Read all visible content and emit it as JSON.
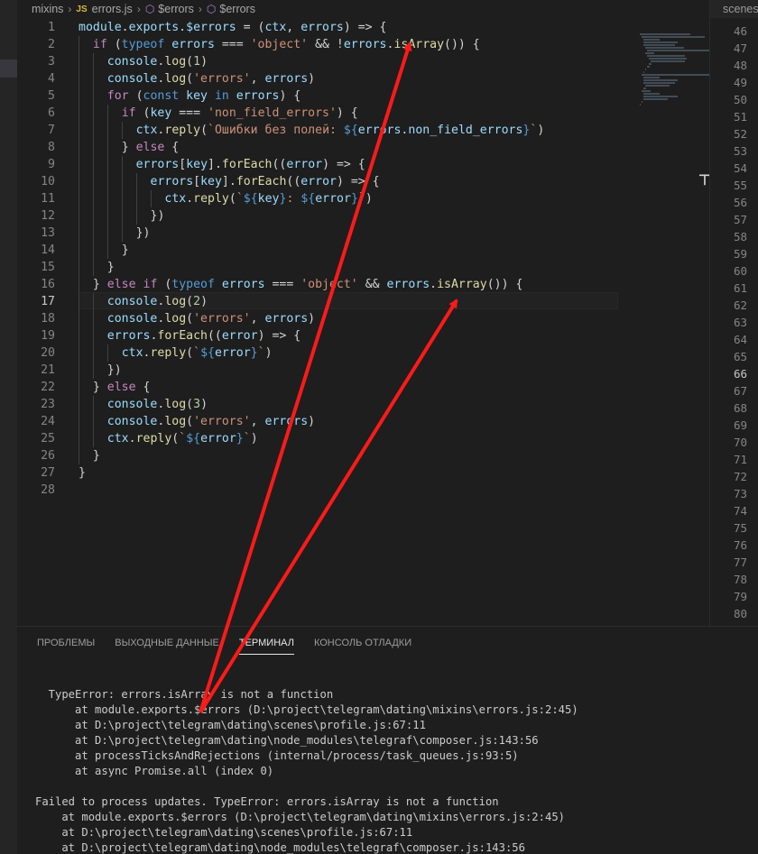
{
  "breadcrumb": {
    "items": [
      "mixins",
      "errors.js",
      "$errors",
      "$errors"
    ],
    "js_badge": "JS"
  },
  "right_pane": {
    "tab_label": "scenes",
    "line_numbers": [
      "46",
      "47",
      "48",
      "49",
      "50",
      "51",
      "52",
      "53",
      "54",
      "55",
      "56",
      "57",
      "58",
      "59",
      "60",
      "61",
      "62",
      "63",
      "64",
      "65",
      "66",
      "67",
      "68",
      "69",
      "70",
      "71",
      "72",
      "73",
      "74",
      "75",
      "76",
      "77",
      "78",
      "79",
      "80"
    ],
    "active_line": "66"
  },
  "editor": {
    "active_line": "17",
    "lines": [
      {
        "n": "1",
        "indent": 0,
        "tokens": [
          {
            "t": "module",
            "c": "var"
          },
          {
            "t": ".",
            "c": "plain"
          },
          {
            "t": "exports",
            "c": "var"
          },
          {
            "t": ".",
            "c": "plain"
          },
          {
            "t": "$errors",
            "c": "var"
          },
          {
            "t": " = (",
            "c": "plain"
          },
          {
            "t": "ctx",
            "c": "var"
          },
          {
            "t": ", ",
            "c": "plain"
          },
          {
            "t": "errors",
            "c": "var"
          },
          {
            "t": ") => {",
            "c": "plain"
          }
        ]
      },
      {
        "n": "2",
        "indent": 1,
        "tokens": [
          {
            "t": "if",
            "c": "kw"
          },
          {
            "t": " (",
            "c": "plain"
          },
          {
            "t": "typeof",
            "c": "kw2"
          },
          {
            "t": " ",
            "c": "plain"
          },
          {
            "t": "errors",
            "c": "var"
          },
          {
            "t": " === ",
            "c": "plain"
          },
          {
            "t": "'object'",
            "c": "str"
          },
          {
            "t": " && !",
            "c": "plain"
          },
          {
            "t": "errors",
            "c": "var"
          },
          {
            "t": ".",
            "c": "plain"
          },
          {
            "t": "isArray",
            "c": "fn"
          },
          {
            "t": "()) {",
            "c": "plain"
          }
        ]
      },
      {
        "n": "3",
        "indent": 2,
        "tokens": [
          {
            "t": "console",
            "c": "var"
          },
          {
            "t": ".",
            "c": "plain"
          },
          {
            "t": "log",
            "c": "fn"
          },
          {
            "t": "(",
            "c": "plain"
          },
          {
            "t": "1",
            "c": "num"
          },
          {
            "t": ")",
            "c": "plain"
          }
        ]
      },
      {
        "n": "4",
        "indent": 2,
        "tokens": [
          {
            "t": "console",
            "c": "var"
          },
          {
            "t": ".",
            "c": "plain"
          },
          {
            "t": "log",
            "c": "fn"
          },
          {
            "t": "(",
            "c": "plain"
          },
          {
            "t": "'errors'",
            "c": "str"
          },
          {
            "t": ", ",
            "c": "plain"
          },
          {
            "t": "errors",
            "c": "var"
          },
          {
            "t": ")",
            "c": "plain"
          }
        ]
      },
      {
        "n": "5",
        "indent": 2,
        "tokens": [
          {
            "t": "for",
            "c": "kw"
          },
          {
            "t": " (",
            "c": "plain"
          },
          {
            "t": "const",
            "c": "kw2"
          },
          {
            "t": " ",
            "c": "plain"
          },
          {
            "t": "key",
            "c": "var"
          },
          {
            "t": " ",
            "c": "plain"
          },
          {
            "t": "in",
            "c": "kw2"
          },
          {
            "t": " ",
            "c": "plain"
          },
          {
            "t": "errors",
            "c": "var"
          },
          {
            "t": ") {",
            "c": "plain"
          }
        ]
      },
      {
        "n": "6",
        "indent": 3,
        "tokens": [
          {
            "t": "if",
            "c": "kw"
          },
          {
            "t": " (",
            "c": "plain"
          },
          {
            "t": "key",
            "c": "var"
          },
          {
            "t": " === ",
            "c": "plain"
          },
          {
            "t": "'non_field_errors'",
            "c": "str"
          },
          {
            "t": ") {",
            "c": "plain"
          }
        ]
      },
      {
        "n": "7",
        "indent": 4,
        "tokens": [
          {
            "t": "ctx",
            "c": "var"
          },
          {
            "t": ".",
            "c": "plain"
          },
          {
            "t": "reply",
            "c": "fn"
          },
          {
            "t": "(",
            "c": "plain"
          },
          {
            "t": "`Ошибки без полей: ",
            "c": "tpl"
          },
          {
            "t": "${",
            "c": "kw2"
          },
          {
            "t": "errors",
            "c": "var"
          },
          {
            "t": ".",
            "c": "plain"
          },
          {
            "t": "non_field_errors",
            "c": "var"
          },
          {
            "t": "}",
            "c": "kw2"
          },
          {
            "t": "`",
            "c": "tpl"
          },
          {
            "t": ")",
            "c": "plain"
          }
        ]
      },
      {
        "n": "8",
        "indent": 3,
        "tokens": [
          {
            "t": "} ",
            "c": "plain"
          },
          {
            "t": "else",
            "c": "kw"
          },
          {
            "t": " {",
            "c": "plain"
          }
        ]
      },
      {
        "n": "9",
        "indent": 4,
        "tokens": [
          {
            "t": "errors",
            "c": "var"
          },
          {
            "t": "[",
            "c": "plain"
          },
          {
            "t": "key",
            "c": "var"
          },
          {
            "t": "].",
            "c": "plain"
          },
          {
            "t": "forEach",
            "c": "fn"
          },
          {
            "t": "((",
            "c": "plain"
          },
          {
            "t": "error",
            "c": "var"
          },
          {
            "t": ") => {",
            "c": "plain"
          }
        ]
      },
      {
        "n": "10",
        "indent": 5,
        "tokens": [
          {
            "t": "errors",
            "c": "var"
          },
          {
            "t": "[",
            "c": "plain"
          },
          {
            "t": "key",
            "c": "var"
          },
          {
            "t": "].",
            "c": "plain"
          },
          {
            "t": "forEach",
            "c": "fn"
          },
          {
            "t": "((",
            "c": "plain"
          },
          {
            "t": "error",
            "c": "var"
          },
          {
            "t": ") => {",
            "c": "plain"
          }
        ]
      },
      {
        "n": "11",
        "indent": 6,
        "tokens": [
          {
            "t": "ctx",
            "c": "var"
          },
          {
            "t": ".",
            "c": "plain"
          },
          {
            "t": "reply",
            "c": "fn"
          },
          {
            "t": "(",
            "c": "plain"
          },
          {
            "t": "`",
            "c": "tpl"
          },
          {
            "t": "${",
            "c": "kw2"
          },
          {
            "t": "key",
            "c": "var"
          },
          {
            "t": "}",
            "c": "kw2"
          },
          {
            "t": ": ",
            "c": "tpl"
          },
          {
            "t": "${",
            "c": "kw2"
          },
          {
            "t": "error",
            "c": "var"
          },
          {
            "t": "}",
            "c": "kw2"
          },
          {
            "t": "`",
            "c": "tpl"
          },
          {
            "t": ")",
            "c": "plain"
          }
        ]
      },
      {
        "n": "12",
        "indent": 5,
        "tokens": [
          {
            "t": "})",
            "c": "plain"
          }
        ]
      },
      {
        "n": "13",
        "indent": 4,
        "tokens": [
          {
            "t": "})",
            "c": "plain"
          }
        ]
      },
      {
        "n": "14",
        "indent": 3,
        "tokens": [
          {
            "t": "}",
            "c": "plain"
          }
        ]
      },
      {
        "n": "15",
        "indent": 2,
        "tokens": [
          {
            "t": "}",
            "c": "plain"
          }
        ]
      },
      {
        "n": "16",
        "indent": 1,
        "tokens": [
          {
            "t": "} ",
            "c": "plain"
          },
          {
            "t": "else",
            "c": "kw"
          },
          {
            "t": " ",
            "c": "plain"
          },
          {
            "t": "if",
            "c": "kw"
          },
          {
            "t": " (",
            "c": "plain"
          },
          {
            "t": "typeof",
            "c": "kw2"
          },
          {
            "t": " ",
            "c": "plain"
          },
          {
            "t": "errors",
            "c": "var"
          },
          {
            "t": " === ",
            "c": "plain"
          },
          {
            "t": "'object'",
            "c": "str"
          },
          {
            "t": " && ",
            "c": "plain"
          },
          {
            "t": "errors",
            "c": "var"
          },
          {
            "t": ".",
            "c": "plain"
          },
          {
            "t": "isArray",
            "c": "fn"
          },
          {
            "t": "()) {",
            "c": "plain"
          }
        ]
      },
      {
        "n": "17",
        "indent": 2,
        "tokens": [
          {
            "t": "console",
            "c": "var"
          },
          {
            "t": ".",
            "c": "plain"
          },
          {
            "t": "log",
            "c": "fn"
          },
          {
            "t": "(",
            "c": "plain"
          },
          {
            "t": "2",
            "c": "num"
          },
          {
            "t": ")",
            "c": "plain"
          }
        ]
      },
      {
        "n": "18",
        "indent": 2,
        "tokens": [
          {
            "t": "console",
            "c": "var"
          },
          {
            "t": ".",
            "c": "plain"
          },
          {
            "t": "log",
            "c": "fn"
          },
          {
            "t": "(",
            "c": "plain"
          },
          {
            "t": "'errors'",
            "c": "str"
          },
          {
            "t": ", ",
            "c": "plain"
          },
          {
            "t": "errors",
            "c": "var"
          },
          {
            "t": ")",
            "c": "plain"
          }
        ]
      },
      {
        "n": "19",
        "indent": 2,
        "tokens": [
          {
            "t": "errors",
            "c": "var"
          },
          {
            "t": ".",
            "c": "plain"
          },
          {
            "t": "forEach",
            "c": "fn"
          },
          {
            "t": "((",
            "c": "plain"
          },
          {
            "t": "error",
            "c": "var"
          },
          {
            "t": ") => {",
            "c": "plain"
          }
        ]
      },
      {
        "n": "20",
        "indent": 3,
        "tokens": [
          {
            "t": "ctx",
            "c": "var"
          },
          {
            "t": ".",
            "c": "plain"
          },
          {
            "t": "reply",
            "c": "fn"
          },
          {
            "t": "(",
            "c": "plain"
          },
          {
            "t": "`",
            "c": "tpl"
          },
          {
            "t": "${",
            "c": "kw2"
          },
          {
            "t": "error",
            "c": "var"
          },
          {
            "t": "}",
            "c": "kw2"
          },
          {
            "t": "`",
            "c": "tpl"
          },
          {
            "t": ")",
            "c": "plain"
          }
        ]
      },
      {
        "n": "21",
        "indent": 2,
        "tokens": [
          {
            "t": "})",
            "c": "plain"
          }
        ]
      },
      {
        "n": "22",
        "indent": 1,
        "tokens": [
          {
            "t": "} ",
            "c": "plain"
          },
          {
            "t": "else",
            "c": "kw"
          },
          {
            "t": " {",
            "c": "plain"
          }
        ]
      },
      {
        "n": "23",
        "indent": 2,
        "tokens": [
          {
            "t": "console",
            "c": "var"
          },
          {
            "t": ".",
            "c": "plain"
          },
          {
            "t": "log",
            "c": "fn"
          },
          {
            "t": "(",
            "c": "plain"
          },
          {
            "t": "3",
            "c": "num"
          },
          {
            "t": ")",
            "c": "plain"
          }
        ]
      },
      {
        "n": "24",
        "indent": 2,
        "tokens": [
          {
            "t": "console",
            "c": "var"
          },
          {
            "t": ".",
            "c": "plain"
          },
          {
            "t": "log",
            "c": "fn"
          },
          {
            "t": "(",
            "c": "plain"
          },
          {
            "t": "'errors'",
            "c": "str"
          },
          {
            "t": ", ",
            "c": "plain"
          },
          {
            "t": "errors",
            "c": "var"
          },
          {
            "t": ")",
            "c": "plain"
          }
        ]
      },
      {
        "n": "25",
        "indent": 2,
        "tokens": [
          {
            "t": "ctx",
            "c": "var"
          },
          {
            "t": ".",
            "c": "plain"
          },
          {
            "t": "reply",
            "c": "fn"
          },
          {
            "t": "(",
            "c": "plain"
          },
          {
            "t": "`",
            "c": "tpl"
          },
          {
            "t": "${",
            "c": "kw2"
          },
          {
            "t": "error",
            "c": "var"
          },
          {
            "t": "}",
            "c": "kw2"
          },
          {
            "t": "`",
            "c": "tpl"
          },
          {
            "t": ")",
            "c": "plain"
          }
        ]
      },
      {
        "n": "26",
        "indent": 1,
        "tokens": [
          {
            "t": "}",
            "c": "plain"
          }
        ]
      },
      {
        "n": "27",
        "indent": 0,
        "tokens": [
          {
            "t": "}",
            "c": "plain"
          }
        ]
      },
      {
        "n": "28",
        "indent": 0,
        "tokens": []
      }
    ]
  },
  "panel": {
    "tabs": [
      {
        "label": "ПРОБЛЕМЫ",
        "active": false
      },
      {
        "label": "ВЫХОДНЫЕ ДАННЫЕ",
        "active": false
      },
      {
        "label": "ТЕРМИНАЛ",
        "active": true
      },
      {
        "label": "КОНСОЛЬ ОТЛАДКИ",
        "active": false
      }
    ],
    "terminal_lines": [
      "  TypeError: errors.isArray is not a function",
      "      at module.exports.$errors (D:\\project\\telegram\\dating\\mixins\\errors.js:2:45)",
      "      at D:\\project\\telegram\\dating\\scenes\\profile.js:67:11",
      "      at D:\\project\\telegram\\dating\\node_modules\\telegraf\\composer.js:143:56",
      "      at processTicksAndRejections (internal/process/task_queues.js:93:5)",
      "      at async Promise.all (index 0)",
      "",
      "Failed to process updates. TypeError: errors.isArray is not a function",
      "    at module.exports.$errors (D:\\project\\telegram\\dating\\mixins\\errors.js:2:45)",
      "    at D:\\project\\telegram\\dating\\scenes\\profile.js:67:11",
      "    at D:\\project\\telegram\\dating\\node_modules\\telegraf\\composer.js:143:56"
    ]
  },
  "colors": {
    "annotation_arrow": "#ff1a1a"
  }
}
